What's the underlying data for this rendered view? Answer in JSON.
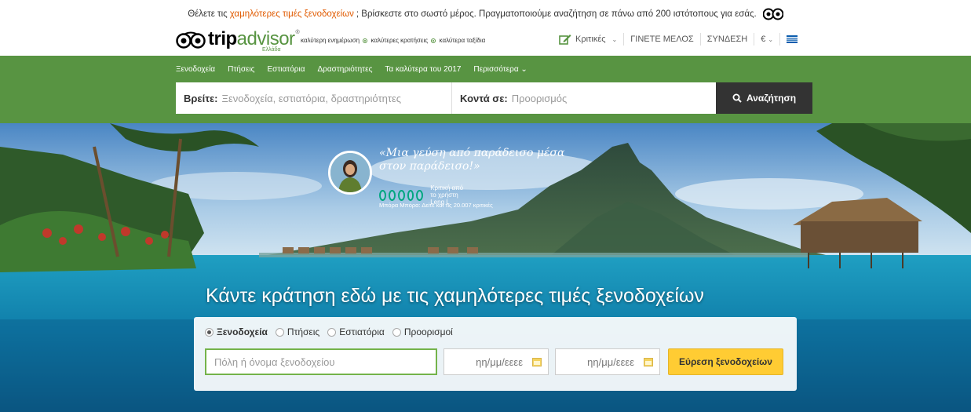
{
  "promo": {
    "text_before": "Θέλετε τις",
    "highlight": "χαμηλότερες τιμές ξενοδοχείων",
    "text_after": "; Βρίσκεστε στο σωστό μέρος. Πραγματοποιούμε αναζήτηση σε πάνω από 200 ιστότοπους για εσάς."
  },
  "header": {
    "logo_trip": "trip",
    "logo_advisor": "advisor",
    "logo_reg": "®",
    "logo_country": "Ελλάδα",
    "tagline": [
      "καλύτερη ενημέρωση",
      "καλύτερες κρατήσεις",
      "καλύτερα ταξίδια"
    ],
    "reviews_label": "Κριτικές",
    "signup_label": "ΓΙΝΕΤΕ ΜΕΛΟΣ",
    "login_label": "ΣΥΝΔΕΣΗ",
    "currency_label": "€"
  },
  "nav": {
    "items": [
      "Ξενοδοχεία",
      "Πτήσεις",
      "Εστιατόρια",
      "Δραστηριότητες",
      "Τα καλύτερα του 2017",
      "Περισσότερα"
    ]
  },
  "search": {
    "where_label": "Βρείτε:",
    "where_placeholder": "Ξενοδοχεία, εστιατόρια, δραστηριότητες",
    "near_label": "Κοντά σε:",
    "near_placeholder": "Προορισμός",
    "button_label": "Αναζήτηση"
  },
  "hero": {
    "quote_line1": "«Μια γεύση από παράδεισο μέσα",
    "quote_line2": "στον παράδεισο!»",
    "review_author": "Κριτική από το χρήστη Leng L",
    "rating_bubbles": 5,
    "place_text": "Μπόρα Μπόρα: Δείτε και τις 20.007 κριτικές",
    "title": "Κάντε κράτηση εδώ με τις χαμηλότερες τιμές ξενοδοχείων"
  },
  "booking": {
    "tabs": [
      "Ξενοδοχεία",
      "Πτήσεις",
      "Εστιατόρια",
      "Προορισμοί"
    ],
    "selected_tab": "Ξενοδοχεία",
    "city_placeholder": "Πόλη ή όνομα ξενοδοχείου",
    "checkin_placeholder": "ηη/μμ/εεεε",
    "checkout_placeholder": "ηη/μμ/εεεε",
    "submit_label": "Εύρεση ξενοδοχείων"
  },
  "colors": {
    "brand_green": "#589442",
    "review_green": "#00a680",
    "promo_orange": "#e05a00",
    "button_yellow": "#ffcc33"
  }
}
